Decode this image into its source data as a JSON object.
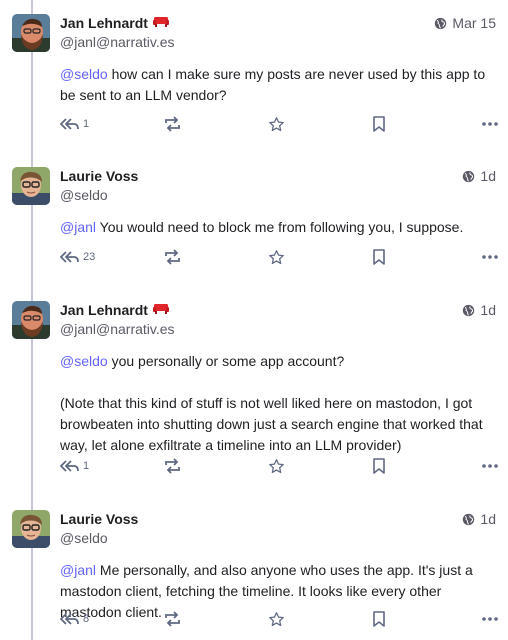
{
  "posts": [
    {
      "display_name": "Jan Lehnardt",
      "handle": "@janl@narrativ.es",
      "has_badge": true,
      "time": "Mar 15",
      "mention": "@seldo",
      "paragraphs": [
        "how can I make sure my posts are never used by this app to be sent to an LLM vendor?"
      ],
      "reply_count": "1",
      "avatar": "bearded-man-avatar"
    },
    {
      "display_name": "Laurie Voss",
      "handle": "@seldo",
      "has_badge": false,
      "time": "1d",
      "mention": "@janl",
      "paragraphs": [
        "You would need to block me from following you, I suppose."
      ],
      "reply_count": "23",
      "avatar": "glasses-man-avatar"
    },
    {
      "display_name": "Jan Lehnardt",
      "handle": "@janl@narrativ.es",
      "has_badge": true,
      "time": "1d",
      "mention": "@seldo",
      "paragraphs": [
        "you personally or some app account?",
        "(Note that this kind of stuff is not well liked here on mastodon, I got browbeaten into shutting down just a search engine that worked that way, let alone exfiltrate a timeline into an LLM provider)"
      ],
      "reply_count": "1",
      "avatar": "bearded-man-avatar"
    },
    {
      "display_name": "Laurie Voss",
      "handle": "@seldo",
      "has_badge": false,
      "time": "1d",
      "mention": "@janl",
      "paragraphs": [
        "Me personally, and also anyone who uses the app. It's just a mastodon client, fetching the timeline. It looks like every other mastodon client."
      ],
      "reply_count": "8",
      "avatar": "glasses-man-avatar"
    }
  ],
  "colors": {
    "mention": "#6364ff",
    "icon": "#606984",
    "thread_line": "#c9c4da",
    "badge": "#e0262b"
  },
  "icons": [
    "globe-icon",
    "reply-all-icon",
    "boost-icon",
    "star-icon",
    "bookmark-icon",
    "more-icon"
  ]
}
